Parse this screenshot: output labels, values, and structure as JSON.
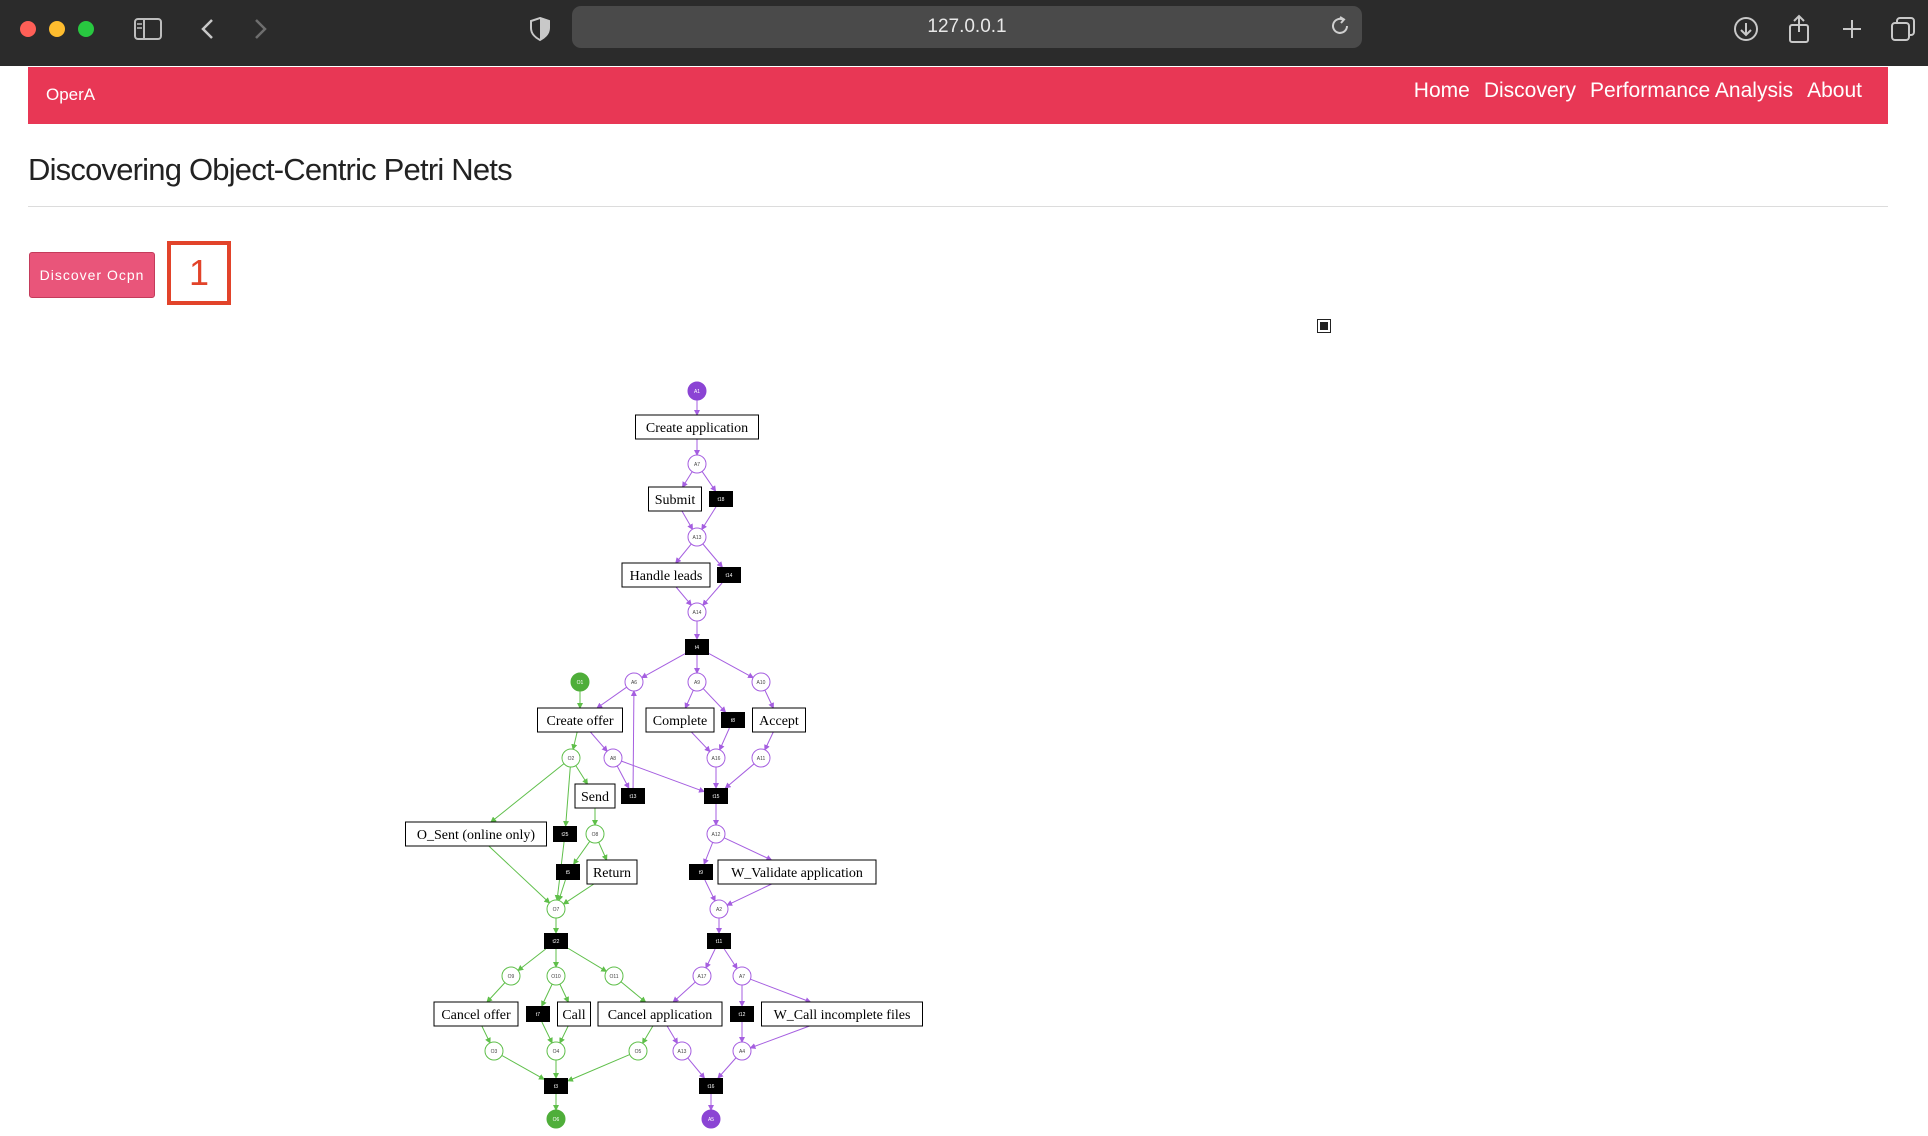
{
  "browser": {
    "url": "127.0.0.1",
    "icons": [
      "sidebar-icon",
      "back-icon",
      "forward-icon",
      "shield-icon",
      "reload-icon",
      "download-icon",
      "share-icon",
      "new-tab-icon",
      "tabs-icon"
    ]
  },
  "navbar": {
    "brand": "OperA",
    "links": [
      "Home",
      "Discovery",
      "Performance Analysis",
      "About"
    ],
    "color": "#e83755"
  },
  "page": {
    "title": "Discovering Object-Centric Petri Nets",
    "discover_button": "Discover Ocpn",
    "annotation_number": "1"
  },
  "petri_net": {
    "colors": {
      "application": "#8b44d4",
      "offer": "#4fae3a",
      "arc_app": "#a55ee0",
      "arc_offer": "#5fbf4a"
    },
    "places": [
      {
        "id": "A1",
        "label": "A1",
        "filled": true,
        "object": "application"
      },
      {
        "id": "A7a",
        "label": "A7",
        "object": "application"
      },
      {
        "id": "A13a",
        "label": "A13",
        "object": "application"
      },
      {
        "id": "A14",
        "label": "A14",
        "object": "application"
      },
      {
        "id": "O1",
        "label": "O1",
        "filled": true,
        "object": "offer"
      },
      {
        "id": "A6",
        "label": "A6",
        "object": "application"
      },
      {
        "id": "A9",
        "label": "A9",
        "object": "application"
      },
      {
        "id": "A10",
        "label": "A10",
        "object": "application"
      },
      {
        "id": "O2",
        "label": "O2",
        "object": "offer"
      },
      {
        "id": "A8",
        "label": "A8",
        "object": "application"
      },
      {
        "id": "A16",
        "label": "A16",
        "object": "application"
      },
      {
        "id": "A11",
        "label": "A11",
        "object": "application"
      },
      {
        "id": "O8",
        "label": "O8",
        "object": "offer"
      },
      {
        "id": "A12",
        "label": "A12",
        "object": "application"
      },
      {
        "id": "O7",
        "label": "O7",
        "object": "offer"
      },
      {
        "id": "A2",
        "label": "A2",
        "object": "application"
      },
      {
        "id": "O9",
        "label": "O9",
        "object": "offer"
      },
      {
        "id": "O10",
        "label": "O10",
        "object": "offer"
      },
      {
        "id": "O11",
        "label": "O11",
        "object": "offer"
      },
      {
        "id": "A17",
        "label": "A17",
        "object": "application"
      },
      {
        "id": "A7b",
        "label": "A7",
        "object": "application"
      },
      {
        "id": "O3",
        "label": "O3",
        "object": "offer"
      },
      {
        "id": "O4",
        "label": "O4",
        "object": "offer"
      },
      {
        "id": "O5",
        "label": "O5",
        "object": "offer"
      },
      {
        "id": "A13b",
        "label": "A13",
        "object": "application"
      },
      {
        "id": "A4",
        "label": "A4",
        "object": "application"
      },
      {
        "id": "O6",
        "label": "O6",
        "filled": true,
        "object": "offer"
      },
      {
        "id": "A5",
        "label": "A5",
        "filled": true,
        "object": "application"
      }
    ],
    "transitions": [
      {
        "id": "t_create_app",
        "label": "Create application"
      },
      {
        "id": "t_submit",
        "label": "Submit"
      },
      {
        "id": "t_hl",
        "label": "Handle leads"
      },
      {
        "id": "t_create_offer",
        "label": "Create offer"
      },
      {
        "id": "t_complete",
        "label": "Complete"
      },
      {
        "id": "t_accept",
        "label": "Accept"
      },
      {
        "id": "t_send",
        "label": "Send"
      },
      {
        "id": "t_osent",
        "label": "O_Sent (online only)"
      },
      {
        "id": "t_return",
        "label": "Return"
      },
      {
        "id": "t_wval",
        "label": "W_Validate application"
      },
      {
        "id": "t_cancel_offer",
        "label": "Cancel offer"
      },
      {
        "id": "t_call",
        "label": "Call"
      },
      {
        "id": "t_cancel_app",
        "label": "Cancel application"
      },
      {
        "id": "t_wcall",
        "label": "W_Call incomplete files"
      },
      {
        "id": "s1",
        "label": "t18"
      },
      {
        "id": "s2",
        "label": "t14"
      },
      {
        "id": "s3",
        "label": "t4"
      },
      {
        "id": "s4",
        "label": "t8"
      },
      {
        "id": "s5",
        "label": "t13"
      },
      {
        "id": "s6",
        "label": "t15"
      },
      {
        "id": "s7",
        "label": "t25"
      },
      {
        "id": "s8",
        "label": "t5"
      },
      {
        "id": "s9",
        "label": "t9"
      },
      {
        "id": "s10",
        "label": "t22"
      },
      {
        "id": "s11",
        "label": "t11"
      },
      {
        "id": "s12",
        "label": "t7"
      },
      {
        "id": "s13",
        "label": "t12"
      },
      {
        "id": "s14",
        "label": "t3"
      },
      {
        "id": "s15",
        "label": "t16"
      }
    ],
    "arcs": [
      [
        "A1",
        "t_create_app",
        "application"
      ],
      [
        "t_create_app",
        "A7a",
        "application"
      ],
      [
        "A7a",
        "t_submit",
        "application"
      ],
      [
        "A7a",
        "s1",
        "application"
      ],
      [
        "t_submit",
        "A13a",
        "application"
      ],
      [
        "s1",
        "A13a",
        "application"
      ],
      [
        "A13a",
        "t_hl",
        "application"
      ],
      [
        "A13a",
        "s2",
        "application"
      ],
      [
        "t_hl",
        "A14",
        "application"
      ],
      [
        "s2",
        "A14",
        "application"
      ],
      [
        "A14",
        "s3",
        "application"
      ],
      [
        "s3",
        "A6",
        "application"
      ],
      [
        "s3",
        "A9",
        "application"
      ],
      [
        "s3",
        "A10",
        "application"
      ],
      [
        "O1",
        "t_create_offer",
        "offer"
      ],
      [
        "A6",
        "t_create_offer",
        "application"
      ],
      [
        "A9",
        "t_complete",
        "application"
      ],
      [
        "A9",
        "s4",
        "application"
      ],
      [
        "A10",
        "t_accept",
        "application"
      ],
      [
        "t_create_offer",
        "O2",
        "offer"
      ],
      [
        "t_create_offer",
        "A8",
        "application"
      ],
      [
        "t_complete",
        "A16",
        "application"
      ],
      [
        "s4",
        "A16",
        "application"
      ],
      [
        "t_accept",
        "A11",
        "application"
      ],
      [
        "A8",
        "s5",
        "application"
      ],
      [
        "s5",
        "A6",
        "application"
      ],
      [
        "A8",
        "s6",
        "application"
      ],
      [
        "A16",
        "s6",
        "application"
      ],
      [
        "A11",
        "s6",
        "application"
      ],
      [
        "O2",
        "t_send",
        "offer"
      ],
      [
        "O2",
        "t_osent",
        "offer"
      ],
      [
        "O2",
        "s7",
        "offer"
      ],
      [
        "t_send",
        "O8",
        "offer"
      ],
      [
        "O8",
        "s8",
        "offer"
      ],
      [
        "O8",
        "t_return",
        "offer"
      ],
      [
        "s6",
        "A12",
        "application"
      ],
      [
        "A12",
        "s9",
        "application"
      ],
      [
        "A12",
        "t_wval",
        "application"
      ],
      [
        "t_osent",
        "O7",
        "offer"
      ],
      [
        "s7",
        "O7",
        "offer"
      ],
      [
        "s8",
        "O7",
        "offer"
      ],
      [
        "t_return",
        "O7",
        "offer"
      ],
      [
        "s9",
        "A2",
        "application"
      ],
      [
        "t_wval",
        "A2",
        "application"
      ],
      [
        "O7",
        "s10",
        "offer"
      ],
      [
        "A2",
        "s11",
        "application"
      ],
      [
        "s10",
        "O9",
        "offer"
      ],
      [
        "s10",
        "O10",
        "offer"
      ],
      [
        "s10",
        "O11",
        "offer"
      ],
      [
        "s11",
        "A17",
        "application"
      ],
      [
        "s11",
        "A7b",
        "application"
      ],
      [
        "O9",
        "t_cancel_offer",
        "offer"
      ],
      [
        "O10",
        "s12",
        "offer"
      ],
      [
        "O10",
        "t_call",
        "offer"
      ],
      [
        "O11",
        "t_cancel_app",
        "offer"
      ],
      [
        "A17",
        "t_cancel_app",
        "application"
      ],
      [
        "A7b",
        "s13",
        "application"
      ],
      [
        "A7b",
        "t_wcall",
        "application"
      ],
      [
        "t_cancel_offer",
        "O3",
        "offer"
      ],
      [
        "s12",
        "O4",
        "offer"
      ],
      [
        "t_call",
        "O4",
        "offer"
      ],
      [
        "t_cancel_app",
        "O5",
        "offer"
      ],
      [
        "t_cancel_app",
        "A13b",
        "application"
      ],
      [
        "s13",
        "A4",
        "application"
      ],
      [
        "t_wcall",
        "A4",
        "application"
      ],
      [
        "O3",
        "s14",
        "offer"
      ],
      [
        "O4",
        "s14",
        "offer"
      ],
      [
        "O5",
        "s14",
        "offer"
      ],
      [
        "A13b",
        "s15",
        "application"
      ],
      [
        "A4",
        "s15",
        "application"
      ],
      [
        "s14",
        "O6",
        "offer"
      ],
      [
        "s15",
        "A5",
        "application"
      ]
    ]
  }
}
